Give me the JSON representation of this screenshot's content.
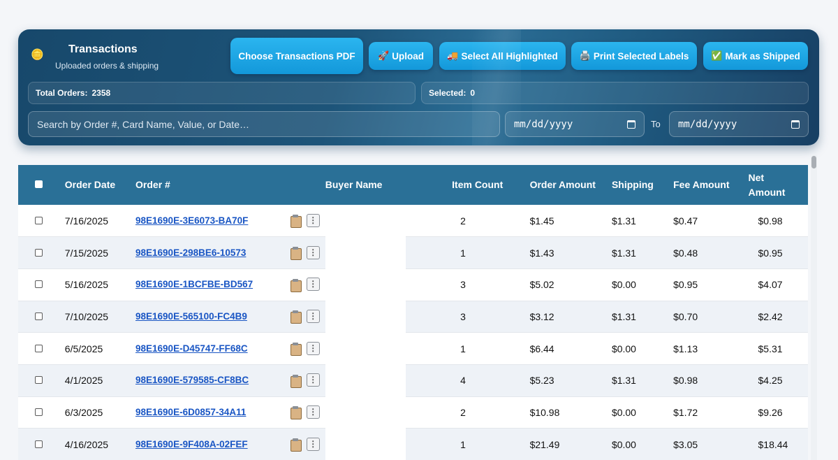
{
  "header": {
    "brand_icon": "🪙",
    "title": "Transactions",
    "subtitle": "Uploaded orders & shipping",
    "buttons": {
      "choose_pdf": "Choose Transactions PDF",
      "upload": "Upload",
      "select_all": "Select All Highlighted",
      "print_labels": "Print Selected Labels",
      "mark_shipped": "Mark as Shipped"
    },
    "button_icons": {
      "upload": "🚀",
      "select_all": "🚚",
      "print_labels": "🖨️",
      "mark_shipped": "✅"
    },
    "stats": {
      "total_label": "Total Orders:",
      "total_value": "2358",
      "selected_label": "Selected:",
      "selected_value": "0"
    },
    "search_placeholder": "Search by Order #, Card Name, Value, or Date…",
    "date_from": "mm/dd/yyyy",
    "to_label": "To",
    "date_to": "mm/dd/yyyy"
  },
  "table": {
    "columns": {
      "order_date": "Order Date",
      "order_num": "Order #",
      "buyer": "Buyer Name",
      "item_count": "Item Count",
      "order_amount": "Order Amount",
      "shipping": "Shipping",
      "fee": "Fee Amount",
      "net": "Net Amount"
    },
    "rows": [
      {
        "date": "7/16/2025",
        "order": "98E1690E-3E6073-BA70F",
        "buyer": "",
        "items": "2",
        "amount": "$1.45",
        "shipping": "$1.31",
        "fee": "$0.47",
        "net": "$0.98"
      },
      {
        "date": "7/15/2025",
        "order": "98E1690E-298BE6-10573",
        "buyer": "",
        "items": "1",
        "amount": "$1.43",
        "shipping": "$1.31",
        "fee": "$0.48",
        "net": "$0.95"
      },
      {
        "date": "5/16/2025",
        "order": "98E1690E-1BCFBE-BD567",
        "buyer": "",
        "items": "3",
        "amount": "$5.02",
        "shipping": "$0.00",
        "fee": "$0.95",
        "net": "$4.07"
      },
      {
        "date": "7/10/2025",
        "order": "98E1690E-565100-FC4B9",
        "buyer": "",
        "items": "3",
        "amount": "$3.12",
        "shipping": "$1.31",
        "fee": "$0.70",
        "net": "$2.42"
      },
      {
        "date": "6/5/2025",
        "order": "98E1690E-D45747-FF68C",
        "buyer": "",
        "items": "1",
        "amount": "$6.44",
        "shipping": "$0.00",
        "fee": "$1.13",
        "net": "$5.31"
      },
      {
        "date": "4/1/2025",
        "order": "98E1690E-579585-CF8BC",
        "buyer": "",
        "items": "4",
        "amount": "$5.23",
        "shipping": "$1.31",
        "fee": "$0.98",
        "net": "$4.25"
      },
      {
        "date": "6/3/2025",
        "order": "98E1690E-6D0857-34A11",
        "buyer": "",
        "items": "2",
        "amount": "$10.98",
        "shipping": "$0.00",
        "fee": "$1.72",
        "net": "$9.26"
      },
      {
        "date": "4/16/2025",
        "order": "98E1690E-9F408A-02FEF",
        "buyer": "",
        "items": "1",
        "amount": "$21.49",
        "shipping": "$0.00",
        "fee": "$3.05",
        "net": "$18.44"
      }
    ]
  },
  "colors": {
    "header_bg": "#1d5479",
    "button_bg": "#1ea6e6",
    "table_header_bg": "#2a7097",
    "link": "#1a56c4",
    "row_alt": "#eef2f7"
  }
}
